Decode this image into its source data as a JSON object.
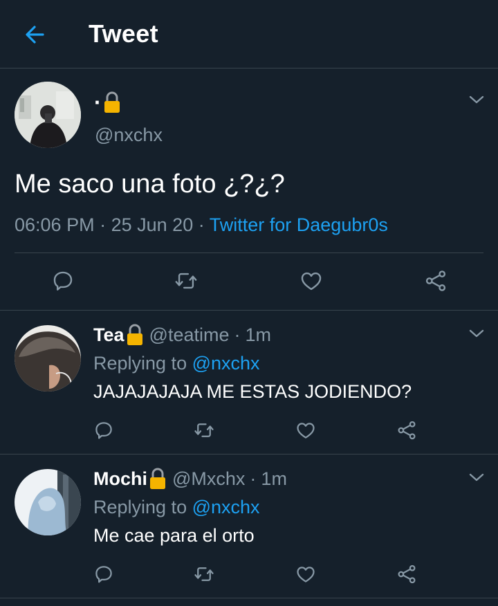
{
  "header": {
    "title": "Tweet"
  },
  "main_tweet": {
    "display_name": "·",
    "handle": "@nxchx",
    "text": "Me saco una foto ¿?¿?",
    "time": "06:06 PM",
    "sep1": "·",
    "date": "25 Jun 20",
    "sep2": "·",
    "source": "Twitter for Daegubr0s"
  },
  "replies": [
    {
      "display_name": "Tea",
      "handle": "@teatime",
      "sep": "·",
      "age": "1m",
      "replying_prefix": "Replying to",
      "replying_handle": "@nxchx",
      "text": "JAJAJAJAJA ME ESTAS JODIENDO?"
    },
    {
      "display_name": "Mochi",
      "handle": "@Mxchx",
      "sep": "·",
      "age": "1m",
      "replying_prefix": "Replying to",
      "replying_handle": "@nxchx",
      "text": "Me cae para el orto"
    }
  ],
  "colors": {
    "background": "#15202b",
    "divider": "#38444d",
    "muted": "#8899a6",
    "accent": "#1da1f2",
    "lock": "#f5b400"
  },
  "icons": [
    "back-arrow-icon",
    "lock-icon",
    "chevron-down-icon",
    "reply-icon",
    "retweet-icon",
    "like-icon",
    "share-icon"
  ]
}
